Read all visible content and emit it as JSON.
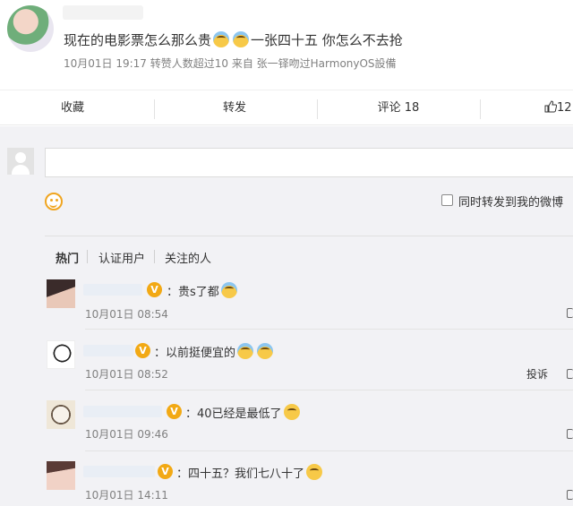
{
  "post": {
    "text_a": "现在的电影票怎么那么贵",
    "text_b": "一张四十五 你怎么不去抢",
    "emoji_1": "laugh-cry-emoji",
    "emoji_2": "laugh-cry-emoji",
    "meta": "10月01日 19:17 转赞人数超过10  来自 张一铎吻过HarmonyOS設備"
  },
  "actions": {
    "collect": "收藏",
    "forward": "转发",
    "comment": "评论 18",
    "like": "12"
  },
  "composer": {
    "emoji_icon": "smile-icon",
    "forward_checkbox_label": "同时转发到我的微博",
    "forward_checked": false
  },
  "filters": [
    "热门",
    "认证用户",
    "关注的人"
  ],
  "comments": [
    {
      "text": "：贵s了都",
      "time": "10月01日 08:54",
      "report": ""
    },
    {
      "text": "：以前挺便宜的",
      "time": "10月01日 08:52",
      "report": "投诉"
    },
    {
      "text": "：40已经是最低了",
      "time": "10月01日 09:46",
      "report": ""
    },
    {
      "text": "：四十五？我们七八十了",
      "time": "10月01日 14:11",
      "report": ""
    }
  ],
  "colors": {
    "accent": "#f2a914",
    "meta_text": "#808080",
    "background": "#f2f2f5"
  }
}
